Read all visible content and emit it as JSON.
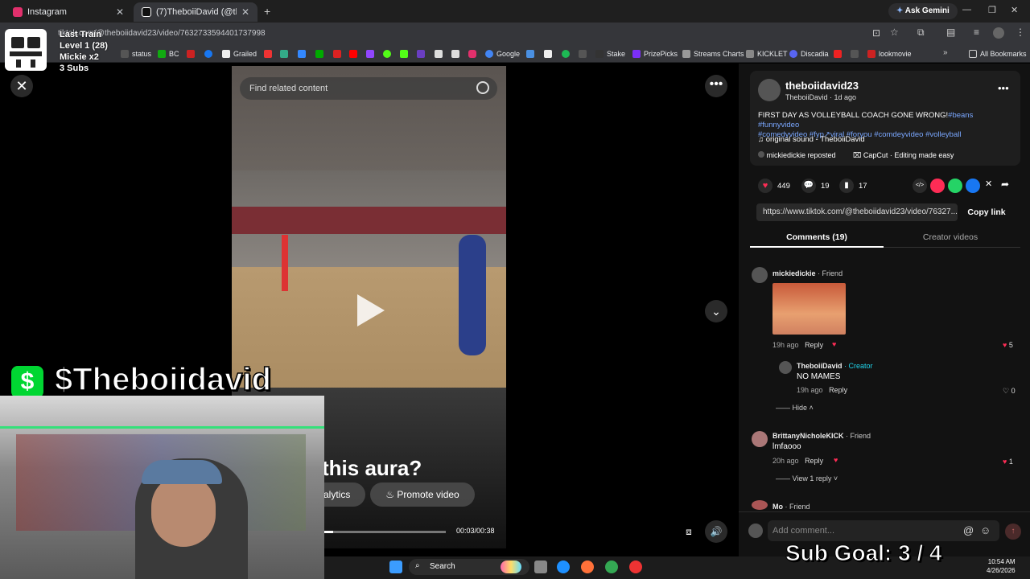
{
  "browser": {
    "tabs": [
      {
        "label": "Instagram",
        "color": "#e1306c"
      },
      {
        "label": "(7)TheboiiDavid (@theboiidavid",
        "color": "#ffffff"
      }
    ],
    "ask_gemini": "Ask Gemini",
    "url": "tiktok.com/@theboiidavid23/video/7632733594401737998",
    "bookmarks": [
      "status",
      "BC",
      "Grailed",
      "Google",
      "Stake",
      "PrizePicks",
      "Streams Charts",
      "KICKLET",
      "Discadia",
      "lookmovie"
    ],
    "all_bookmarks": "All Bookmarks"
  },
  "stream_overlay": {
    "train_title": "Last Train",
    "train_level": "Level 1  (28)",
    "train_user": "Mickie x2",
    "train_subs": "3 Subs",
    "cashtag": "$Theboiidavid",
    "sub_goal": "Sub Goal:  3 / 4"
  },
  "video": {
    "search_placeholder": "Find related content",
    "caption_overlay": "this aura?",
    "analytics_label": "alytics",
    "promote_label": "Promote video",
    "time": "00:03/00:38",
    "progress": 0.08
  },
  "post": {
    "username": "theboiidavid23",
    "display_name": "TheboiiDavid · 1d ago",
    "description_text": "FIRST DAY AS VOLLEYBALL COACH GONE WRONG!",
    "description_tags_1": "#beans #funnyvideo",
    "description_tags_2": "#comedyvideo #fyp↗viral #foryou #comdeyvideo #volleyball",
    "sound": "original sound - TheboiiDavid",
    "reposted": "mickiedickie reposted",
    "capcut": "CapCut · Editing made easy",
    "likes": "449",
    "comments": "19",
    "saves": "17",
    "link": "https://www.tiktok.com/@theboiidavid23/video/76327...",
    "copy_link": "Copy link",
    "tab_comments": "Comments (19)",
    "tab_creator": "Creator videos"
  },
  "comments": [
    {
      "name": "mickiedickie",
      "badge": "· Friend",
      "meta": "19h ago",
      "reply": "Reply",
      "likes": "5"
    },
    {
      "name": "TheboiiDavid",
      "badge": "· Creator",
      "text": "NO MAMES",
      "meta": "19h ago",
      "reply": "Reply",
      "likes": "0"
    },
    {
      "name": "BrittanyNicholeKICK",
      "badge": "· Friend",
      "text": "lmfaooo",
      "meta": "20h ago",
      "reply": "Reply",
      "likes": "1"
    },
    {
      "name": "Mo",
      "badge": "· Friend"
    }
  ],
  "hide_label": "Hide",
  "view_reply": "View 1 reply",
  "add_comment": "Add comment...",
  "taskbar": {
    "search": "Search",
    "time": "10:54 AM",
    "date": "4/26/2026"
  }
}
